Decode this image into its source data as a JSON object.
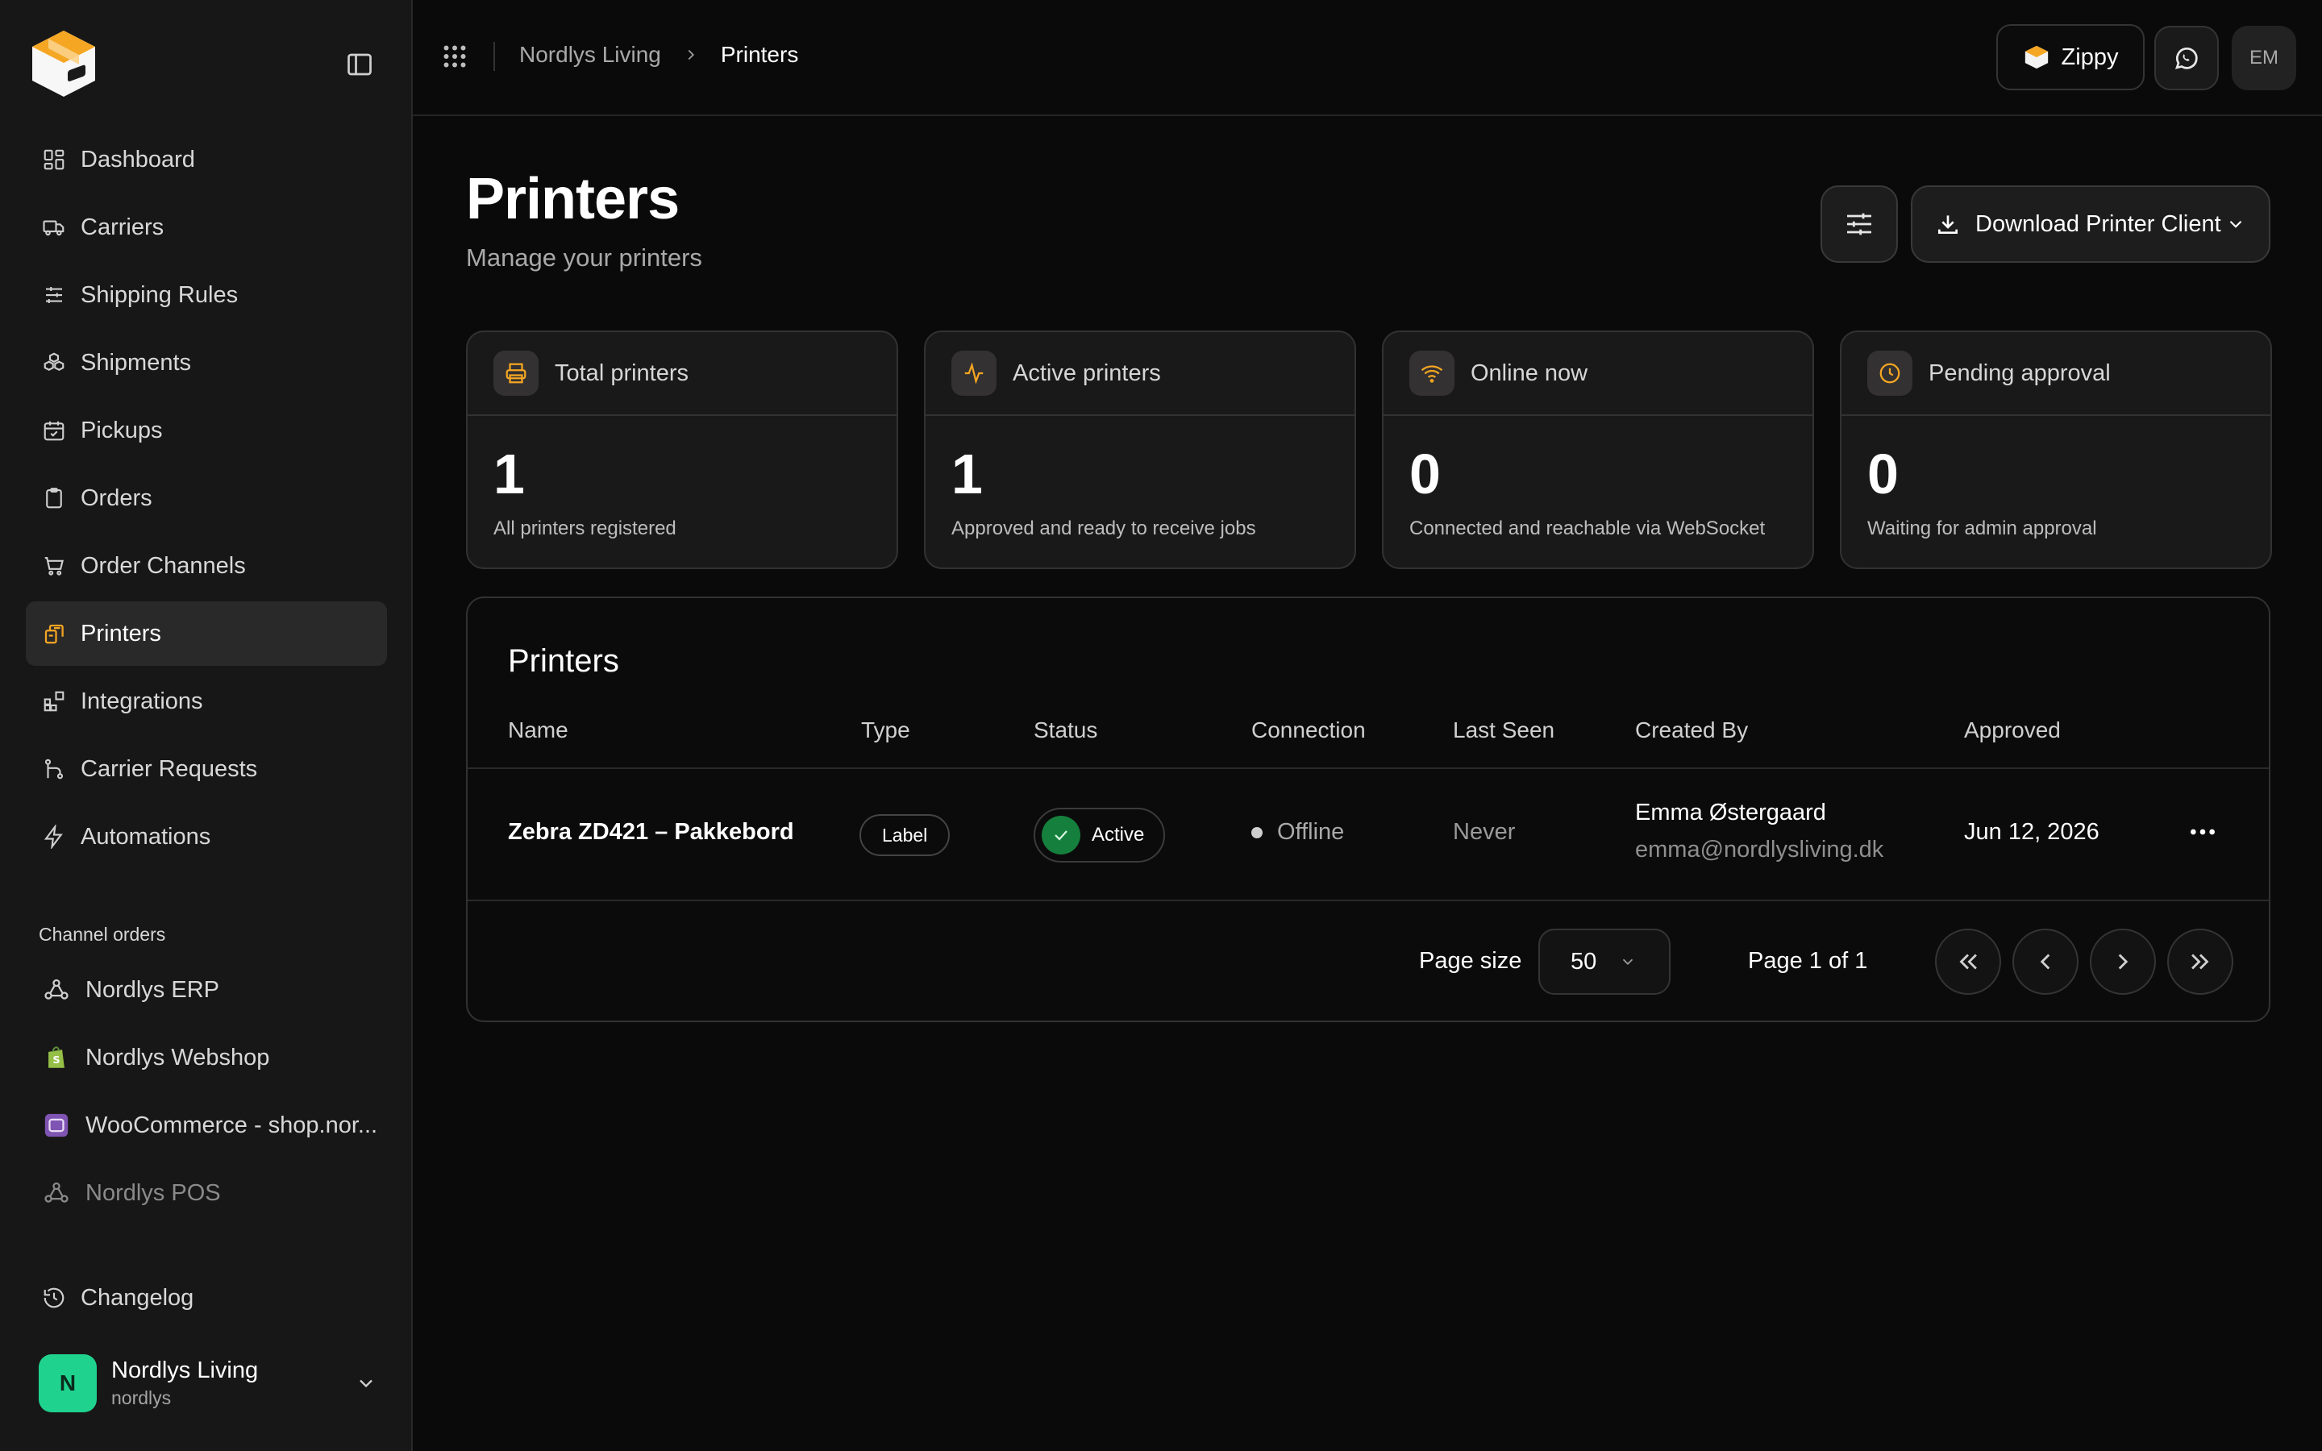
{
  "sidebar": {
    "nav": [
      {
        "label": "Dashboard",
        "icon": "dashboard-icon"
      },
      {
        "label": "Carriers",
        "icon": "truck-icon"
      },
      {
        "label": "Shipping Rules",
        "icon": "sliders-icon"
      },
      {
        "label": "Shipments",
        "icon": "boxes-icon"
      },
      {
        "label": "Pickups",
        "icon": "calendar-icon"
      },
      {
        "label": "Orders",
        "icon": "clipboard-icon"
      },
      {
        "label": "Order Channels",
        "icon": "cart-icon"
      },
      {
        "label": "Printers",
        "icon": "printers-icon",
        "active": true
      },
      {
        "label": "Integrations",
        "icon": "blocks-icon"
      },
      {
        "label": "Carrier Requests",
        "icon": "git-branch-icon"
      },
      {
        "label": "Automations",
        "icon": "bolt-icon"
      }
    ],
    "channels_label": "Channel orders",
    "channels": [
      {
        "label": "Nordlys ERP",
        "icon": "webhook-icon"
      },
      {
        "label": "Nordlys Webshop",
        "icon": "shopify-icon"
      },
      {
        "label": "WooCommerce - shop.nor...",
        "icon": "woocommerce-icon"
      },
      {
        "label": "Nordlys POS",
        "icon": "webhook-icon"
      }
    ],
    "changelog": "Changelog",
    "account": {
      "initial": "N",
      "name": "Nordlys Living",
      "handle": "nordlys"
    }
  },
  "topbar": {
    "breadcrumb_parent": "Nordlys Living",
    "breadcrumb_current": "Printers",
    "zippy_label": "Zippy",
    "user_initials": "EM"
  },
  "header": {
    "title": "Printers",
    "subtitle": "Manage your printers",
    "download_label": "Download Printer Client"
  },
  "stats": [
    {
      "label": "Total printers",
      "value": "1",
      "desc": "All printers registered",
      "icon": "printer-icon"
    },
    {
      "label": "Active printers",
      "value": "1",
      "desc": "Approved and ready to receive jobs",
      "icon": "activity-icon"
    },
    {
      "label": "Online now",
      "value": "0",
      "desc": "Connected and reachable via WebSocket",
      "icon": "wifi-icon"
    },
    {
      "label": "Pending approval",
      "value": "0",
      "desc": "Waiting for admin approval",
      "icon": "clock-icon"
    }
  ],
  "table": {
    "title": "Printers",
    "columns": [
      "Name",
      "Type",
      "Status",
      "Connection",
      "Last Seen",
      "Created By",
      "Approved"
    ],
    "rows": [
      {
        "name": "Zebra ZD421 – Pakkebord",
        "type": "Label",
        "status": "Active",
        "connection": "Offline",
        "last_seen": "Never",
        "created_by_name": "Emma Østergaard",
        "created_by_email": "emma@nordlysliving.dk",
        "approved": "Jun 12, 2026"
      }
    ],
    "pagination": {
      "page_size_label": "Page size",
      "page_size": "50",
      "page_info": "Page 1 of 1"
    }
  },
  "colors": {
    "accent": "#f5a623",
    "active_green": "#15803d",
    "avatar_green": "#1fd38f"
  }
}
